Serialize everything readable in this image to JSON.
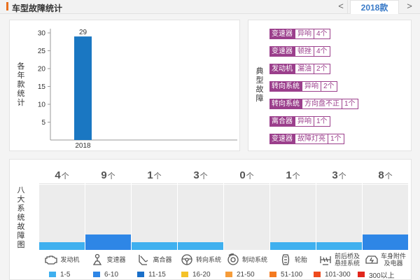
{
  "header": {
    "title": "车型故障统计",
    "prev_label": "<",
    "year_tab": "2018款",
    "next_label": ">"
  },
  "yearly_chart": {
    "axis_title_chars": [
      "各",
      "年",
      "款",
      "统",
      "计"
    ],
    "ticks": [
      "30",
      "25",
      "20",
      "15",
      "10",
      "5"
    ],
    "bar_label": "29",
    "category": "2018"
  },
  "chart_data": {
    "type": "bar",
    "categories": [
      "2018"
    ],
    "values": [
      29
    ],
    "title": "",
    "xlabel": "",
    "ylabel": "各年款统计",
    "ylim": [
      0,
      30
    ],
    "grid": false,
    "bar_color": "#1a77c2"
  },
  "typical": {
    "title_chars": [
      "典",
      "型",
      "故",
      "障"
    ],
    "rows": [
      {
        "part": "变速器",
        "issue": "异响",
        "count": "4个"
      },
      {
        "part": "变速器",
        "issue": "顿挫",
        "count": "4个"
      },
      {
        "part": "发动机",
        "issue": "漏油",
        "count": "2个"
      },
      {
        "part": "转向系统",
        "issue": "异响",
        "count": "2个"
      },
      {
        "part": "转向系统",
        "issue": "方向盘不正",
        "count": "1个"
      },
      {
        "part": "离合器",
        "issue": "异响",
        "count": "1个"
      },
      {
        "part": "变速器",
        "issue": "故障灯亮",
        "count": "1个"
      }
    ],
    "colors": {
      "tag": "#9b3f8c"
    }
  },
  "systems": {
    "title_chars": [
      "八",
      "大",
      "系",
      "统",
      "故",
      "障",
      "图"
    ],
    "unit": "个",
    "items": [
      {
        "name": "发动机",
        "count": "4",
        "level": "1-5",
        "color": "#3fb0ef",
        "icon": "engine-icon"
      },
      {
        "name": "变速器",
        "count": "9",
        "level": "6-10",
        "color": "#2e86e6",
        "icon": "gearshift-icon"
      },
      {
        "name": "离合器",
        "count": "1",
        "level": "1-5",
        "color": "#3fb0ef",
        "icon": "clutch-pedal-icon"
      },
      {
        "name": "转向系统",
        "count": "3",
        "level": "1-5",
        "color": "#3fb0ef",
        "icon": "steering-wheel-icon"
      },
      {
        "name": "制动系统",
        "count": "0",
        "level": "0",
        "color": "",
        "icon": "brake-disc-icon"
      },
      {
        "name": "轮胎",
        "count": "1",
        "level": "1-5",
        "color": "#3fb0ef",
        "icon": "tire-icon"
      },
      {
        "name_line1": "前后桥及",
        "name_line2": "悬挂系统",
        "count": "3",
        "level": "1-5",
        "color": "#3fb0ef",
        "icon": "suspension-icon"
      },
      {
        "name_line1": "车身附件",
        "name_line2": "及电器",
        "count": "8",
        "level": "6-10",
        "color": "#2e86e6",
        "icon": "electrical-icon"
      }
    ]
  },
  "legend": [
    {
      "label": "1-5",
      "color": "#3fb0ef"
    },
    {
      "label": "6-10",
      "color": "#2e86e6"
    },
    {
      "label": "11-15",
      "color": "#1a6fc9"
    },
    {
      "label": "16-20",
      "color": "#f4c228"
    },
    {
      "label": "21-50",
      "color": "#f59c3a"
    },
    {
      "label": "51-100",
      "color": "#f47a20"
    },
    {
      "label": "101-300",
      "color": "#ef4b1d"
    },
    {
      "label": "300以上",
      "color": "#e1261c"
    }
  ]
}
